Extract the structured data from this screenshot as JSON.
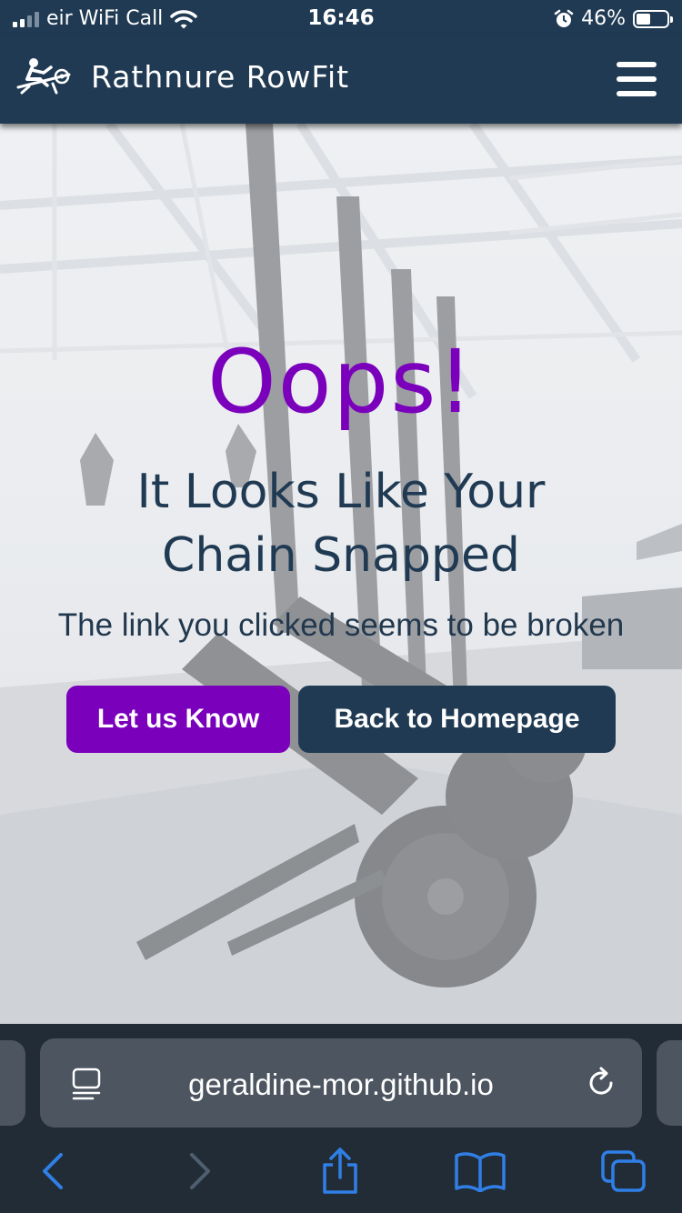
{
  "status_bar": {
    "carrier": "eir WiFi Call",
    "time": "16:46",
    "battery_percent": "46%",
    "battery_level": 0.46,
    "icons": [
      "signal-icon",
      "wifi-icon",
      "alarm-icon",
      "battery-icon"
    ]
  },
  "navbar": {
    "brand": "Rathnure RowFit",
    "logo_icon": "rower-logo-icon",
    "menu_icon": "hamburger-menu-icon"
  },
  "hero": {
    "title": "Oops!",
    "headline_line1": "It Looks Like Your",
    "headline_line2": "Chain Snapped",
    "subtitle": "The link you clicked seems to be broken",
    "primary_button": "Let us Know",
    "secondary_button": "Back to Homepage"
  },
  "browser": {
    "url": "geraldine-mor.github.io",
    "icons": [
      "reader-icon",
      "reload-icon",
      "back-icon",
      "forward-icon",
      "share-icon",
      "bookmarks-icon",
      "tabs-icon"
    ]
  },
  "colors": {
    "navy": "#1f3a52",
    "purple": "#7a00bc",
    "ios_blue": "#2f7fe6"
  }
}
